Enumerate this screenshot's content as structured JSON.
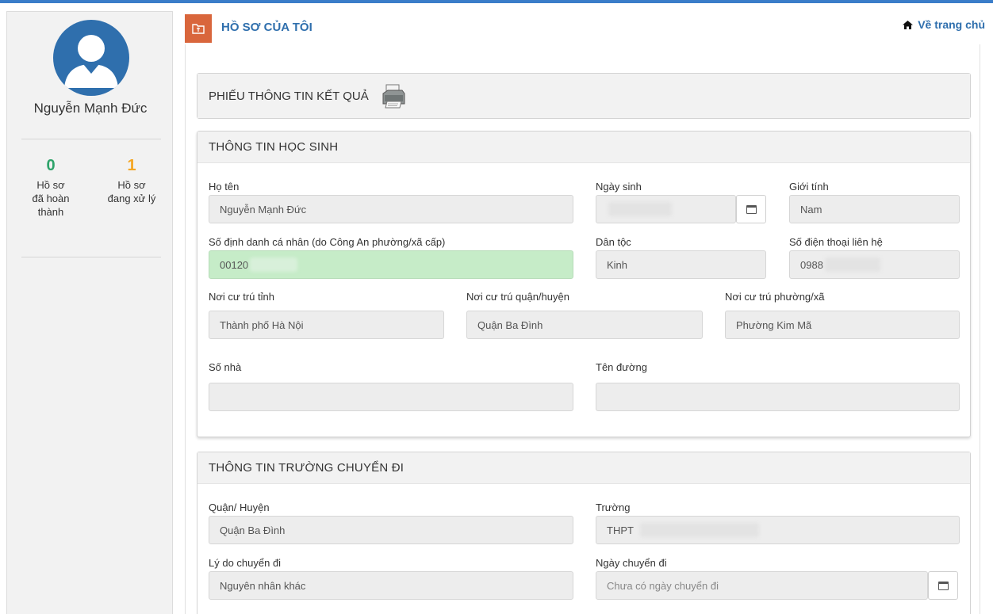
{
  "sidebar": {
    "user_name": "Nguyễn Mạnh Đức",
    "stats": [
      {
        "count": "0",
        "label_lines": [
          "Hồ sơ",
          "đã hoàn",
          "thành"
        ],
        "color": "#2ea36a"
      },
      {
        "count": "1",
        "label_lines": [
          "Hồ sơ",
          "đang xử lý"
        ],
        "color": "#f5a623"
      }
    ]
  },
  "header": {
    "title": "HỒ SƠ CỦA TÔI",
    "home_link": "Về trang chủ"
  },
  "result_panel": {
    "title": "PHIẾU THÔNG TIN KẾT QUẢ"
  },
  "student_panel": {
    "title": "THÔNG TIN HỌC SINH",
    "fields": {
      "ho_ten": {
        "label": "Họ tên",
        "value": "Nguyễn Mạnh Đức"
      },
      "ngay_sinh": {
        "label": "Ngày sinh",
        "value": ""
      },
      "gioi_tinh": {
        "label": "Giới tính",
        "value": "Nam"
      },
      "so_dinh_danh": {
        "label": "Số định danh cá nhân (do Công An phường/xã cấp)",
        "value": "00120"
      },
      "dan_toc": {
        "label": "Dân tộc",
        "value": "Kinh"
      },
      "so_dien_thoai": {
        "label": "Số điện thoại liên hệ",
        "value": "0988"
      },
      "tinh": {
        "label": "Nơi cư trú tỉnh",
        "value": "Thành phố Hà Nội"
      },
      "quan_huyen": {
        "label": "Nơi cư trú quận/huyện",
        "value": "Quận Ba Đình"
      },
      "phuong_xa": {
        "label": "Nơi cư trú phường/xã",
        "value": "Phường Kim Mã"
      },
      "so_nha": {
        "label": "Số nhà",
        "value": ""
      },
      "ten_duong": {
        "label": "Tên đường",
        "value": ""
      }
    }
  },
  "transfer_panel": {
    "title": "THÔNG TIN TRƯỜNG CHUYỂN ĐI",
    "fields": {
      "quan_huyen": {
        "label": "Quận/ Huyện",
        "value": "Quận Ba Đình"
      },
      "truong": {
        "label": "Trường",
        "value": "THPT"
      },
      "ly_do": {
        "label": "Lý do chuyển đi",
        "value": "Nguyên nhân khác"
      },
      "ngay_chuyen": {
        "label": "Ngày chuyển đi",
        "value": "",
        "placeholder": "Chưa có ngày chuyển đi"
      }
    }
  },
  "icons": [
    "user-avatar-icon",
    "folder-icon",
    "home-icon",
    "printer-icon",
    "calendar-icon"
  ],
  "colors": {
    "accent": "#2f6fad",
    "header_box": "#d9663c",
    "completed": "#2ea36a",
    "processing": "#f5a623",
    "highlight_field": "#c6ecc8"
  }
}
